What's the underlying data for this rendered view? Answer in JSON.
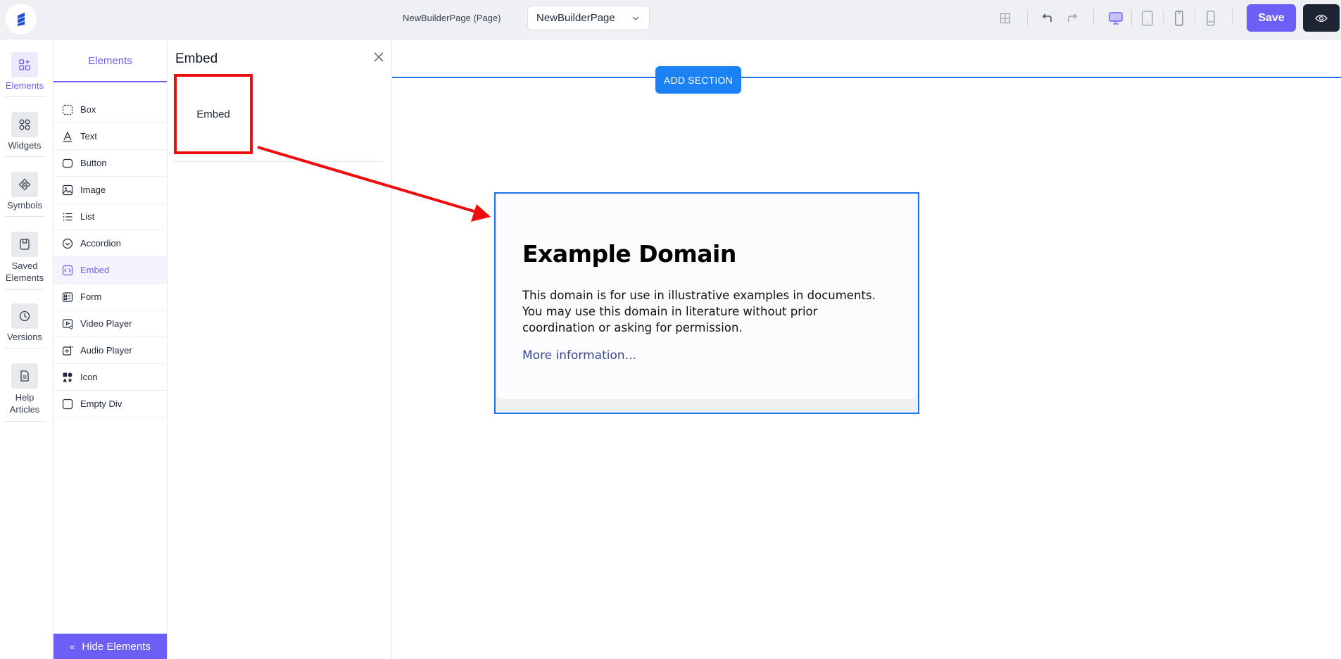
{
  "topbar": {
    "page_title": "NewBuilderPage (Page)",
    "page_select_value": "NewBuilderPage",
    "save_label": "Save"
  },
  "rail": {
    "items": [
      {
        "label": "Elements",
        "icon": "elements-icon"
      },
      {
        "label": "Widgets",
        "icon": "widgets-icon"
      },
      {
        "label": "Symbols",
        "icon": "symbols-icon"
      },
      {
        "label": "Saved Elements",
        "icon": "saved-elements-icon"
      },
      {
        "label": "Versions",
        "icon": "versions-icon"
      },
      {
        "label": "Help Articles",
        "icon": "help-articles-icon"
      }
    ]
  },
  "elements_panel": {
    "tab_label": "Elements",
    "items": [
      {
        "label": "Box",
        "icon": "box-icon"
      },
      {
        "label": "Text",
        "icon": "text-icon"
      },
      {
        "label": "Button",
        "icon": "button-icon"
      },
      {
        "label": "Image",
        "icon": "image-icon"
      },
      {
        "label": "List",
        "icon": "list-icon"
      },
      {
        "label": "Accordion",
        "icon": "accordion-icon"
      },
      {
        "label": "Embed",
        "icon": "embed-icon"
      },
      {
        "label": "Form",
        "icon": "form-icon"
      },
      {
        "label": "Video Player",
        "icon": "video-player-icon"
      },
      {
        "label": "Audio Player",
        "icon": "audio-player-icon"
      },
      {
        "label": "Icon",
        "icon": "icon-icon"
      },
      {
        "label": "Empty Div",
        "icon": "empty-div-icon"
      }
    ],
    "hide_label": "Hide Elements"
  },
  "embed_panel": {
    "title": "Embed",
    "card_label": "Embed"
  },
  "canvas": {
    "add_section_label": "ADD SECTION",
    "embed_content": {
      "heading": "Example Domain",
      "paragraph": "This domain is for use in illustrative examples in documents. You may use this domain in literature without prior coordination or asking for permission.",
      "link": "More information..."
    }
  },
  "colors": {
    "accent": "#6d5ff5",
    "primary_blue": "#1a82f5",
    "annotation_red": "#ee0d0d",
    "dark_button": "#1e2433"
  }
}
